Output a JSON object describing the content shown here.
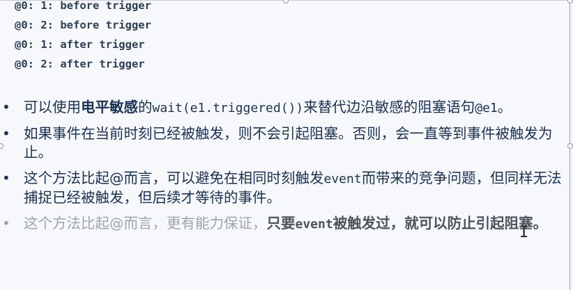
{
  "code_output": [
    "@0: 1: before trigger",
    "@0: 2: before trigger",
    "@0: 1: after trigger",
    "@0: 2: after trigger"
  ],
  "bullets": [
    {
      "marker": "•",
      "p1": "可以使用",
      "p2": "电平敏感",
      "p3": "的",
      "p4": "wait(e1.triggered())",
      "p5": "来替代边沿敏感的阻塞语句",
      "p6": "@e1",
      "p7": "。"
    },
    {
      "marker": "•",
      "text": "如果事件在当前时刻已经被触发，则不会引起阻塞。否则，会一直等到事件被触发为止。"
    },
    {
      "marker": "•",
      "p1": "这个方法比起@而言，可以避免在相同时刻触发",
      "p2": "event",
      "p3": "而带来的竞争问题，但同样无法捕捉已经被触发，但后续才等待的事件。"
    },
    {
      "marker": "•",
      "p1": "这个方法比起@而言，更有能力保证，",
      "p2": "只要",
      "p3": "event",
      "p4": "被触发过，就可以防止引起阻塞。"
    }
  ],
  "cursor": {
    "glyph": "I",
    "icon": "text-cursor-icon"
  }
}
